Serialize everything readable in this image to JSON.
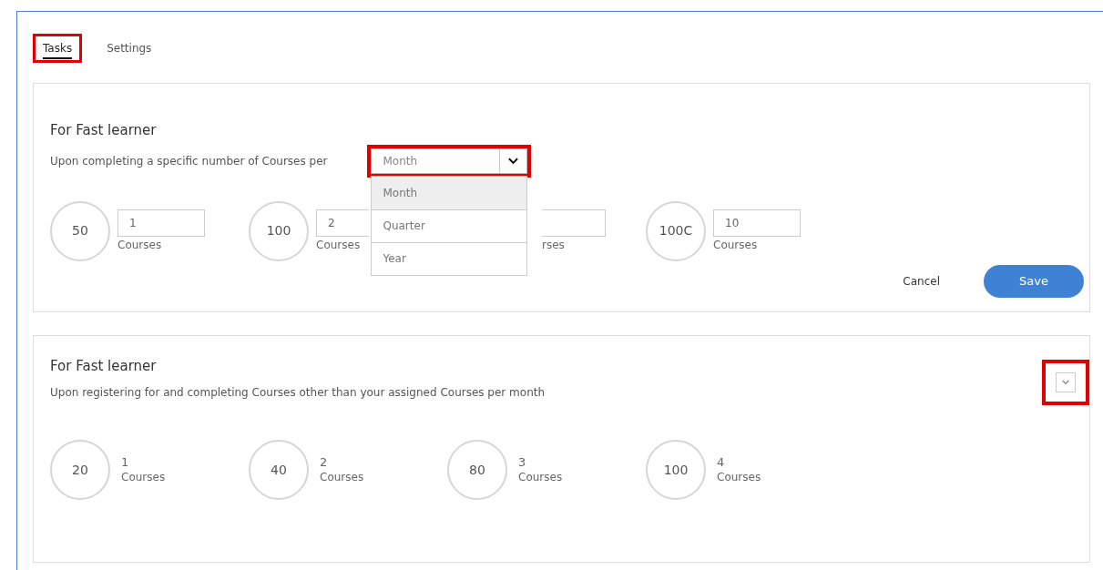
{
  "tabs": [
    {
      "label": "Tasks",
      "selected": true,
      "highlighted": true
    },
    {
      "label": "Settings",
      "selected": false,
      "highlighted": false
    }
  ],
  "cards": [
    {
      "title": "For Fast learner",
      "description": "Upon completing a specific number of Courses per",
      "period_select": {
        "value": "Month",
        "highlighted": true,
        "expanded": true,
        "options": [
          {
            "label": "Month",
            "selected": true
          },
          {
            "label": "Quarter",
            "selected": false
          },
          {
            "label": "Year",
            "selected": false
          }
        ]
      },
      "tiers": [
        {
          "kind": "editable",
          "points": "50",
          "count": "1",
          "unit": "Courses"
        },
        {
          "kind": "editable",
          "points": "100",
          "count": "2",
          "unit": "Courses"
        },
        {
          "kind": "covered",
          "unit": "rses"
        },
        {
          "kind": "editable",
          "points": "100C",
          "count": "10",
          "unit": "Courses"
        }
      ],
      "buttons": [
        {
          "kind": "text",
          "label": "Cancel"
        },
        {
          "kind": "primary",
          "label": "Save"
        }
      ]
    },
    {
      "title": "For Fast learner",
      "description": "Upon registering for and completing Courses other than your assigned Courses per month",
      "expand_toggle": {
        "expanded": false,
        "highlighted": true
      },
      "tiers": [
        {
          "kind": "static",
          "points": "20",
          "count": "1",
          "unit": "Courses"
        },
        {
          "kind": "static",
          "points": "40",
          "count": "2",
          "unit": "Courses"
        },
        {
          "kind": "static",
          "points": "80",
          "count": "3",
          "unit": "Courses"
        },
        {
          "kind": "static",
          "points": "100",
          "count": "4",
          "unit": "Courses"
        }
      ]
    }
  ]
}
